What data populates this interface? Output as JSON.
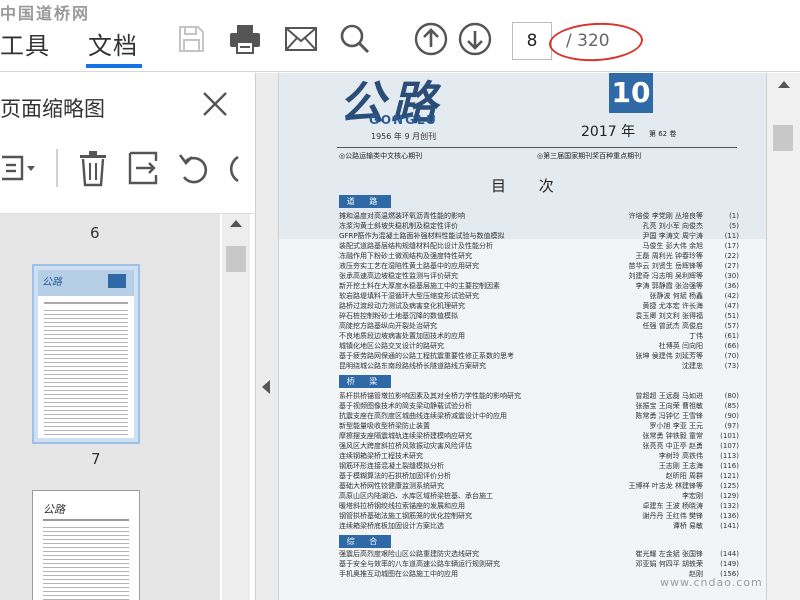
{
  "watermark_top": "中国道桥网",
  "watermark_bottom": "www.cndao.com",
  "toolbar": {
    "tabs": [
      {
        "label": "工具"
      },
      {
        "label": "文档"
      }
    ],
    "current_page": "8",
    "total_pages": "/ 320"
  },
  "left_panel": {
    "title": "页面缩略图",
    "thumbnails": [
      {
        "label": "6"
      },
      {
        "label": "7"
      }
    ]
  },
  "document": {
    "journal_name_latin": "GONGLU",
    "founded": "1956 年 9 月创刊",
    "year": "2017 年",
    "issue_number": "10",
    "volume": "第 62 卷",
    "tagline_left": "◎公路运输类中文核心期刊",
    "tagline_right": "◎第三届国家期刊奖百种重点期刊",
    "toc_title": "目 次",
    "sections": [
      {
        "name": "道 路",
        "entries": [
          {
            "title": "摊和温度对高温燃装环氧沥青性能的影响",
            "authors": "许培俊 李党刚 丛培良等",
            "page": "(1)"
          },
          {
            "title": "冻浆沟黄土斜坡失稳机制及稳定性评价",
            "authors": "孔亮 刘小军 向俊杰",
            "page": "(5)"
          },
          {
            "title": "GFRP筋作为混凝土路面补强材料性能试验与数值模拟",
            "authors": "尹国 李涛文 周宁涛",
            "page": "(11)"
          },
          {
            "title": "装配式道路基层结构规缝材料配比设计及性能分析",
            "authors": "马俊生 彭大伟 余旭",
            "page": "(17)"
          },
          {
            "title": "冻融作用下粉砂土微观结构及强度特性研究",
            "authors": "王磊 周利光 钟春玲等",
            "page": "(22)"
          },
          {
            "title": "液压夯实工艺在湿陷性黄土路基中的应用研究",
            "authors": "苗华云 刘贤生 岳辉锋等",
            "page": "(27)"
          },
          {
            "title": "张承高速高边坡稳定性监测与评价研究",
            "authors": "刘建奇 冯志明 吴利辉等",
            "page": "(30)"
          },
          {
            "title": "新开挖土料在大厚度水稳基层施工中的主要控制因素",
            "authors": "李涛 郭静霞 张治强等",
            "page": "(36)"
          },
          {
            "title": "软岩路堤填料干湿循环大型压缩变形试验研究",
            "authors": "张静波 何斌 杨鑫",
            "page": "(42)"
          },
          {
            "title": "路桥过渡段动力测试及病害变化机理研究",
            "authors": "黄捷 尤本宏 许长海",
            "page": "(47)"
          },
          {
            "title": "碎石桩控制粉砂土地基沉降的数值模拟",
            "authors": "袁玉卿 刘文利 张得福",
            "page": "(51)"
          },
          {
            "title": "高陡挖方路基纵向开裂处治研究",
            "authors": "任强 曾武杰 高俊启",
            "page": "(57)"
          },
          {
            "title": "不良地质段边坡病害处置加固技术的应用",
            "authors": "丁伟",
            "page": "(61)"
          },
          {
            "title": "城镇化地区公路交叉设计的路研究",
            "authors": "杜博英 闫向阳",
            "page": "(66)"
          },
          {
            "title": "基于疲劳路网保通的公路工程抗震重要性修正系数的思考",
            "authors": "张坤 侯建伟 刘延芳等",
            "page": "(70)"
          },
          {
            "title": "昆明绕城公路东南段路线桥长隧道路线方案研究",
            "authors": "沈建忠",
            "page": "(73)"
          }
        ]
      },
      {
        "name": "桥 梁",
        "entries": [
          {
            "title": "系杆拱桥锚管墩拉影响因素及其对全桥力学性能的影响研究",
            "authors": "曾超超 王远磊 马如进",
            "page": "(80)"
          },
          {
            "title": "基于视频图像技术的简支梁动静载试验分析",
            "authors": "张振宝 王向荣 曹祖敏",
            "page": "(85)"
          },
          {
            "title": "抗震支座在高烈度区城曲线连续梁桥减震设计中的应用",
            "authors": "陈常勇 冯钟亿 王雪锋",
            "page": "(90)"
          },
          {
            "title": "新型能量吸收型桥梁防止装置",
            "authors": "罗小旭 李亚 王元",
            "page": "(97)"
          },
          {
            "title": "摩擦摆支座隔震城轨连续梁桥建模响应研究",
            "authors": "张常勇 钟铁毅 童常",
            "page": "(101)"
          },
          {
            "title": "强风区大跨度斜拉桥风致振动灾害风险评估",
            "authors": "张亮亮 中正亭 赵勇",
            "page": "(107)"
          },
          {
            "title": "连续钢箱梁桥工程技术研究",
            "authors": "李树玲 高铁伟",
            "page": "(113)"
          },
          {
            "title": "钢筋环形连接混凝土裂缝模拟分析",
            "authors": "王志刚 王志海",
            "page": "(116)"
          },
          {
            "title": "基于模糊算法的石拱桥加固评价分析",
            "authors": "赵昕阳 周群",
            "page": "(121)"
          },
          {
            "title": "基础大桥网性铰健康监测系统研究",
            "authors": "王博祥 叶志龙 林建锋等",
            "page": "(125)"
          },
          {
            "title": "高原山区内陆湖泊、水库区域桥梁桩基、承台施工",
            "authors": "李宏刚",
            "page": "(129)"
          },
          {
            "title": "暖塔斜拉桥钢绞线拉索锚座的发展和应用",
            "authors": "卓建东 王波 杨晓涛",
            "page": "(132)"
          },
          {
            "title": "钢管拱桥基础法施工钢筋笼的优化控制研究",
            "authors": "谢丹丹 王红伟 樊锋",
            "page": "(136)"
          },
          {
            "title": "连续箱梁桥底板加固设计方案比选",
            "authors": "谭桥 易敏",
            "page": "(141)"
          }
        ]
      },
      {
        "name": "综 合",
        "entries": [
          {
            "title": "强震后高烈度艰险山区公路重建防灾选线研究",
            "authors": "崔光耀 左金斌 张国锋",
            "page": "(144)"
          },
          {
            "title": "基于安全与效率的八车道高速公路车辆运行规则研究",
            "authors": "邓亚娟 何四平 胡轶荣",
            "page": "(149)"
          },
          {
            "title": "手机奥推互动城图在公路施工中的应用",
            "authors": "赵刚",
            "page": "(156)"
          }
        ]
      }
    ]
  }
}
